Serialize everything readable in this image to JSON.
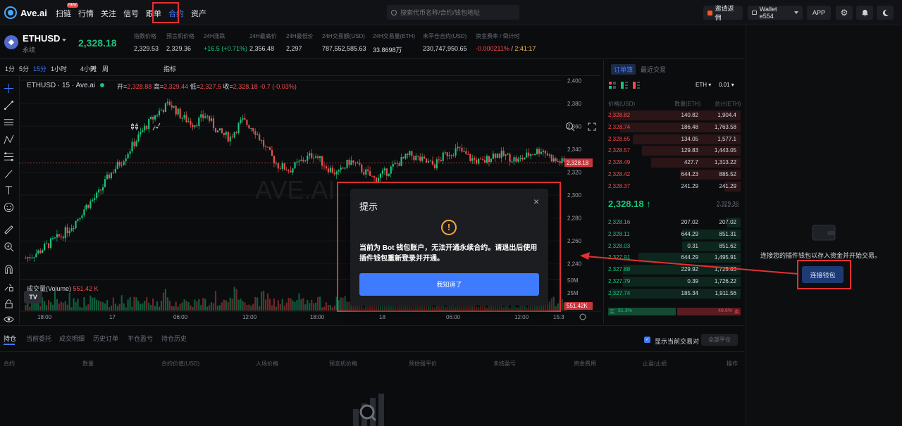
{
  "brand": {
    "name": "Ave.ai"
  },
  "nav": {
    "items": [
      {
        "label": "扫链",
        "badge": "NEW"
      },
      {
        "label": "行情"
      },
      {
        "label": "关注"
      },
      {
        "label": "信号"
      },
      {
        "label": "跟单"
      },
      {
        "label": "合约"
      },
      {
        "label": "资产"
      }
    ],
    "active_index": 5
  },
  "search": {
    "placeholder": "搜索代币名称/合约/钱包地址"
  },
  "header_right": {
    "invite": "邀请返佣",
    "wallet": "Wallet e554",
    "app": "APP"
  },
  "ticker": {
    "symbol": "ETHUSD",
    "subtitle": "永续",
    "price": "2,328.18",
    "stats": [
      {
        "label": "指数价格",
        "value": "2,329.53",
        "color": "normal"
      },
      {
        "label": "预言机价格",
        "value": "2,329.36",
        "color": "normal"
      },
      {
        "label": "24H涨跌",
        "value": "+16.5 (+0.71%)",
        "color": "green"
      },
      {
        "label": "24H最高价",
        "value": "2,356.48",
        "color": "normal"
      },
      {
        "label": "24H最低价",
        "value": "2,297",
        "color": "normal"
      },
      {
        "label": "24H交易额(USD)",
        "value": "787,552,585.63",
        "color": "normal"
      },
      {
        "label": "24H交易量(ETH)",
        "value": "33.8698万",
        "color": "normal"
      },
      {
        "label": "未平仓合约(USD)",
        "value": "230,747,950.65",
        "color": "normal"
      },
      {
        "label": "资金费率 / 倒计时",
        "value": "-0.000211%",
        "value2": "2:41:17",
        "color": "red"
      }
    ]
  },
  "chart_toolbar": {
    "timeframes": [
      "1分",
      "5分",
      "15分",
      "1小时",
      "4小时",
      "天",
      "周"
    ],
    "active_index": 2,
    "indicators": "指标"
  },
  "chart": {
    "title": "ETHUSD · 15 · Ave.ai",
    "ohlc": {
      "open_label": "开=",
      "open": "2,328.88",
      "high_label": "高=",
      "high": "2,329.44",
      "low_label": "低=",
      "low": "2,327.5",
      "close_label": "收=",
      "close": "2,328.18",
      "change": "-0.7 (-0.03%)"
    },
    "watermark": "AVE.AI",
    "volume_label": "成交量(Volume)",
    "volume_value": "551.42 K",
    "last_price_tag": "2,328.18",
    "volume_tag": "551.42K",
    "x_labels": [
      "18:00",
      "17",
      "06:00",
      "12:00",
      "18:00",
      "18",
      "06:00",
      "12:00",
      "15:3"
    ],
    "y_labels": [
      "2,400",
      "2,380",
      "2,360",
      "2,340",
      "2,320",
      "2,300",
      "2,280",
      "2,260",
      "2,240"
    ],
    "vol_y_labels": [
      "50M",
      "25M"
    ]
  },
  "chart_data": {
    "type": "candlestick",
    "interval": "15m",
    "ylim": [
      2230,
      2402
    ],
    "y_ticks": [
      2240,
      2260,
      2280,
      2300,
      2320,
      2340,
      2360,
      2380,
      2400
    ],
    "last_price": 2328.18,
    "closes_approx": [
      2245,
      2250,
      2258,
      2265,
      2275,
      2290,
      2300,
      2318,
      2330,
      2345,
      2360,
      2372,
      2380,
      2368,
      2362,
      2370,
      2355,
      2350,
      2365,
      2358,
      2340,
      2326,
      2322,
      2330,
      2336,
      2325,
      2318,
      2330,
      2322,
      2314,
      2320,
      2328,
      2335,
      2330,
      2326,
      2336,
      2340,
      2332,
      2328,
      2336,
      2334,
      2330,
      2336,
      2340,
      2330,
      2328
    ]
  },
  "order_book": {
    "tabs": [
      "订单簿",
      "最近交易"
    ],
    "active_tab": 0,
    "coin_select": "ETH",
    "tick_select": "0.01",
    "headers": [
      "价格(USD)",
      "数量(ETH)",
      "总计(ETH)"
    ],
    "asks": [
      [
        "2,328.82",
        "140.82",
        "1,904.4"
      ],
      [
        "2,328.74",
        "186.48",
        "1,763.58"
      ],
      [
        "2,328.65",
        "134.05",
        "1,577.1"
      ],
      [
        "2,328.57",
        "129.83",
        "1,443.05"
      ],
      [
        "2,328.49",
        "427.7",
        "1,313.22"
      ],
      [
        "2,328.42",
        "644.23",
        "885.52"
      ],
      [
        "2,328.37",
        "241.29",
        "241.29"
      ]
    ],
    "mid_price": "2,328.18",
    "mid_arrow": "↑",
    "mid_ref": "2,329.36",
    "bids": [
      [
        "2,328.16",
        "207.02",
        "207.02"
      ],
      [
        "2,328.11",
        "644.29",
        "851.31"
      ],
      [
        "2,328.03",
        "0.31",
        "851.62"
      ],
      [
        "2,327.91",
        "644.29",
        "1,495.91"
      ],
      [
        "2,327.88",
        "229.92",
        "1,725.83"
      ],
      [
        "2,327.79",
        "0.39",
        "1,726.22"
      ],
      [
        "2,327.74",
        "185.34",
        "1,911.56"
      ]
    ],
    "ratio_buy_label": "买",
    "ratio_buy": "51.3%",
    "ratio_sell": "48.6%",
    "ratio_sell_label": "卖"
  },
  "wallet_panel": {
    "message": "连接您的插件钱包以存入资金并开始交易。",
    "connect": "连接钱包"
  },
  "bottom": {
    "tabs": [
      "持仓",
      "当前委托",
      "成交明细",
      "历史订单",
      "平仓盈亏",
      "持仓历史"
    ],
    "active_tab": 0,
    "show_current": "显示当前交易对",
    "close_all": "全部平仓",
    "columns": [
      "合约",
      "数量",
      "合约价值(USD)",
      "入场价格",
      "预言机价格",
      "预估强平价",
      "未结盈亏",
      "资金费用",
      "止盈/止损",
      "操作"
    ]
  },
  "modal": {
    "title": "提示",
    "close": "×",
    "message": "当前为 Bot 钱包账户，无法开通永续合约。请退出后使用插件钱包重新登录并开通。",
    "button": "我知道了"
  },
  "colors": {
    "up": "#19c37d",
    "down": "#f04c4c",
    "accent": "#3f7bff",
    "annotation": "#e53030"
  }
}
